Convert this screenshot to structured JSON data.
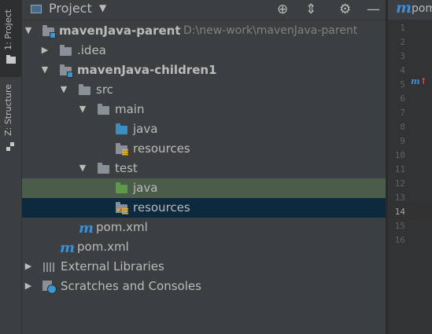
{
  "tool_stripe": {
    "project_tab": "1: Project",
    "structure_tab": "Z: Structure"
  },
  "panel": {
    "title": "Project",
    "dropdown_icon": "chevron-down-icon",
    "header_icons": [
      "locate-icon",
      "collapse-all-icon",
      "gear-icon",
      "minimize-icon"
    ],
    "locate_glyph": "⊕",
    "collapse_glyph": "⇕",
    "gear_glyph": "⚙",
    "minimize_glyph": "—"
  },
  "tree": [
    {
      "label": "mavenJava-parent",
      "path": "D:\\new-work\\mavenJava-parent",
      "expanded": true
    },
    {
      "label": ".idea",
      "expanded": false
    },
    {
      "label": "mavenJava-children1",
      "expanded": true
    },
    {
      "label": "src",
      "expanded": true
    },
    {
      "label": "main",
      "expanded": true
    },
    {
      "label": "java"
    },
    {
      "label": "resources"
    },
    {
      "label": "test",
      "expanded": true
    },
    {
      "label": "java",
      "state": "selected-inactive"
    },
    {
      "label": "resources",
      "state": "selected"
    },
    {
      "label": "pom.xml"
    },
    {
      "label": "pom.xml"
    },
    {
      "label": "External Libraries",
      "expanded": false
    },
    {
      "label": "Scratches and Consoles",
      "expanded": false
    }
  ],
  "editor": {
    "tab_label": "pom",
    "tab_icon": "maven-icon",
    "line_numbers": [
      "1",
      "2",
      "3",
      "4",
      "5",
      "6",
      "7",
      "8",
      "9",
      "10",
      "11",
      "12",
      "13",
      "14",
      "15",
      "16"
    ],
    "current_line": "14",
    "gutter_marker": "m",
    "gutter_marker_arrow": "↑"
  },
  "colors": {
    "panel_bg": "#3c3f41",
    "selected_bg": "#0d293e",
    "inactive_selected_bg": "#4b5c4b",
    "source_folder": "#3a8ec2",
    "test_folder": "#5c9a4a",
    "maven_blue": "#3b8fd8"
  }
}
